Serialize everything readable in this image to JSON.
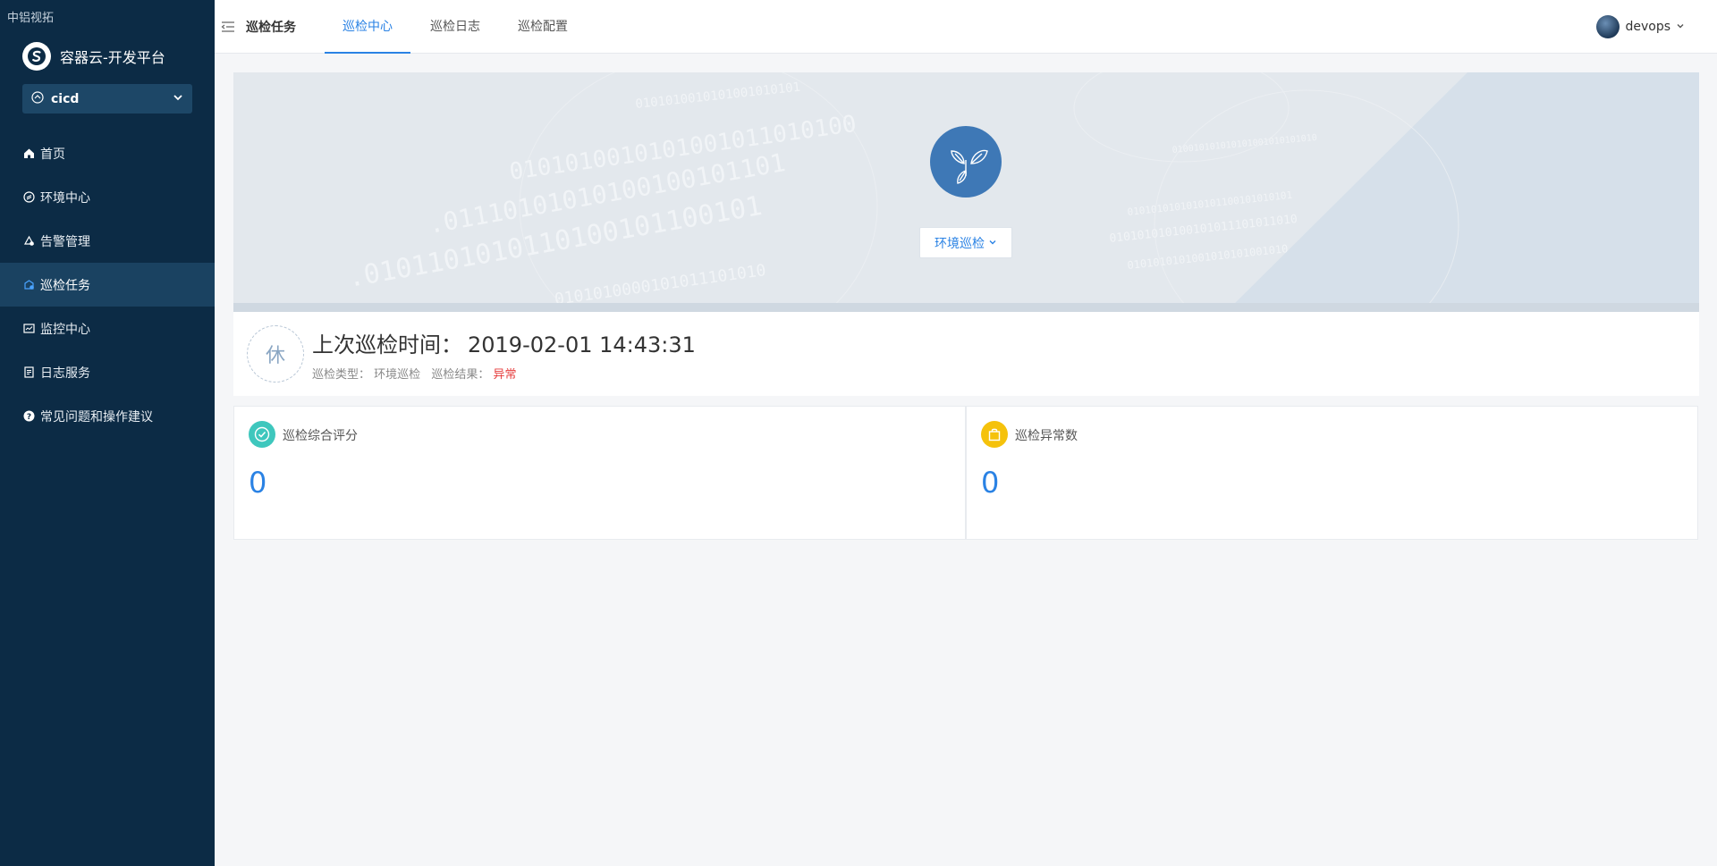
{
  "corner_note": "中铝视拓",
  "brand": {
    "title": "容器云-开发平台"
  },
  "project": {
    "name": "cicd"
  },
  "menu": [
    {
      "label": "首页",
      "icon": "home-icon"
    },
    {
      "label": "环境中心",
      "icon": "environment-icon"
    },
    {
      "label": "告警管理",
      "icon": "alert-icon"
    },
    {
      "label": "巡检任务",
      "icon": "inspection-icon",
      "active": true
    },
    {
      "label": "监控中心",
      "icon": "monitor-icon"
    },
    {
      "label": "日志服务",
      "icon": "log-icon"
    },
    {
      "label": "常见问题和操作建议",
      "icon": "help-icon"
    }
  ],
  "header": {
    "section_title": "巡检任务",
    "tabs": [
      {
        "label": "巡检中心",
        "active": true
      },
      {
        "label": "巡检日志"
      },
      {
        "label": "巡检配置"
      }
    ],
    "user": "devops"
  },
  "banner": {
    "type_select": "环境巡检"
  },
  "info": {
    "status_char": "休",
    "last_time_label": "上次巡检时间：",
    "last_time_value": "2019-02-01 14:43:31",
    "type_label": "巡检类型：",
    "type_value": "环境巡检",
    "result_label": "巡检结果：",
    "result_value": "异常"
  },
  "stats": [
    {
      "label": "巡检综合评分",
      "value": "0",
      "icon": "check-circle-icon",
      "color": "#3ec7bd"
    },
    {
      "label": "巡检异常数",
      "value": "0",
      "icon": "bag-icon",
      "color": "#f5c20c"
    }
  ],
  "colors": {
    "sidebar": "#0c2b45",
    "accent": "#2a82e4",
    "danger": "#e63c3c"
  }
}
